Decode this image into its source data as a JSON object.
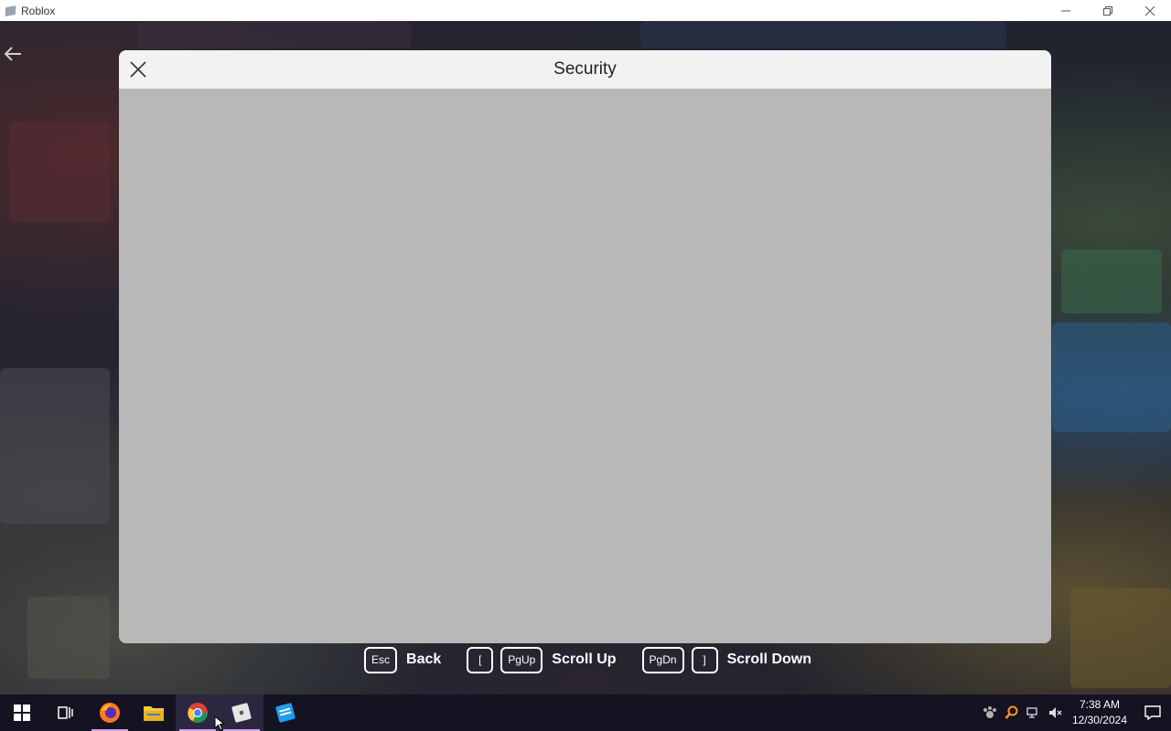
{
  "window": {
    "title": "Roblox"
  },
  "dialog": {
    "title": "Security"
  },
  "hints": {
    "back_key": "Esc",
    "back_label": "Back",
    "scroll_up_key_1": "[",
    "scroll_up_key_2": "PgUp",
    "scroll_up_label": "Scroll Up",
    "scroll_down_key_1": "PgDn",
    "scroll_down_key_2": "]",
    "scroll_down_label": "Scroll Down"
  },
  "taskbar": {
    "items": [
      "start-icon",
      "task-view-icon",
      "firefox-icon",
      "file-explorer-icon",
      "chrome-icon",
      "roblox-icon",
      "roblox-studio-icon"
    ],
    "clock_time": "7:38 AM",
    "clock_date": "12/30/2024"
  },
  "colors": {
    "dialog_body": "#b8b8b8",
    "dialog_header": "#f2f2f2",
    "taskbar": "#151222"
  }
}
